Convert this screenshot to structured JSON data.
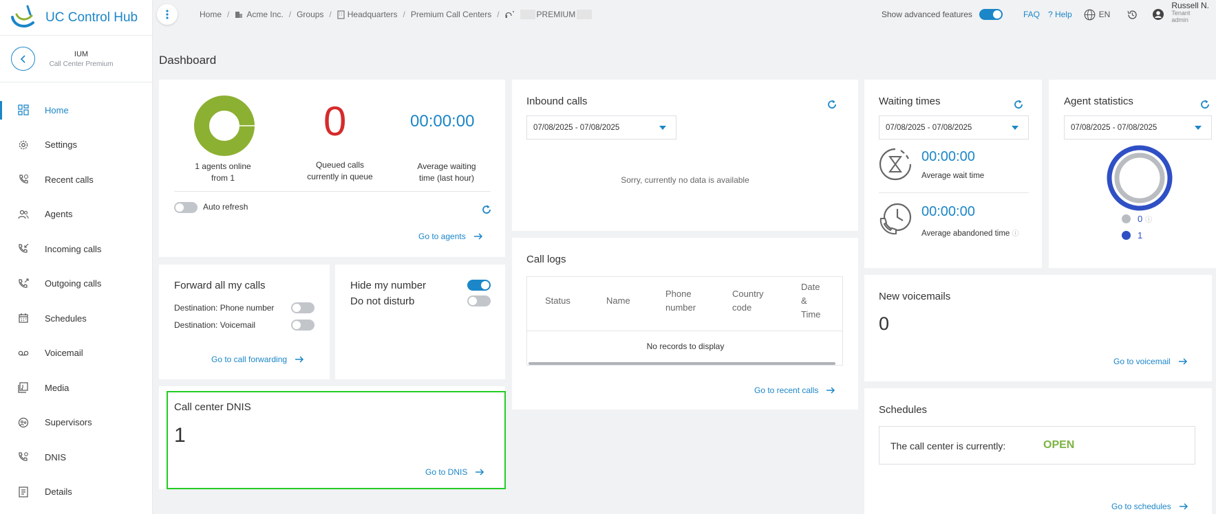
{
  "app": {
    "name": "UC Control Hub"
  },
  "context": {
    "name": "IUM",
    "subtitle": "Call Center Premium"
  },
  "breadcrumbs": [
    "Home",
    "Acme Inc.",
    "Groups",
    "Headquarters",
    "Premium Call Centers",
    "PREMIUM"
  ],
  "topbar": {
    "advanced_label": "Show advanced features",
    "advanced_on": true,
    "faq": "FAQ",
    "help": "? Help",
    "language": "EN",
    "user_name": "Russell N.",
    "user_role_1": "Tenant",
    "user_role_2": "admin"
  },
  "sidebar": {
    "items": [
      {
        "label": "Home",
        "icon": "dashboard-icon",
        "active": true
      },
      {
        "label": "Settings",
        "icon": "gear-icon"
      },
      {
        "label": "Recent calls",
        "icon": "phone-clock-icon"
      },
      {
        "label": "Agents",
        "icon": "users-icon"
      },
      {
        "label": "Incoming calls",
        "icon": "phone-incoming-icon"
      },
      {
        "label": "Outgoing calls",
        "icon": "phone-outgoing-icon"
      },
      {
        "label": "Schedules",
        "icon": "calendar-icon"
      },
      {
        "label": "Voicemail",
        "icon": "voicemail-icon"
      },
      {
        "label": "Media",
        "icon": "media-icon"
      },
      {
        "label": "Supervisors",
        "icon": "supervisor-icon"
      },
      {
        "label": "DNIS",
        "icon": "phone-settings-icon"
      },
      {
        "label": "Details",
        "icon": "details-icon"
      }
    ]
  },
  "page_title": "Dashboard",
  "overview": {
    "agents_caption_1": "1 agents online",
    "agents_caption_2": "from 1",
    "agents_online_fraction": 1.0,
    "queued_value": "0",
    "queued_caption_1": "Queued calls",
    "queued_caption_2": "currently in queue",
    "avg_wait_value": "00:00:00",
    "avg_wait_caption_1": "Average waiting",
    "avg_wait_caption_2": "time (last hour)",
    "auto_refresh_label": "Auto refresh",
    "auto_refresh_on": false,
    "go_label": "Go to agents"
  },
  "forward": {
    "title": "Forward all my calls",
    "dest_phone": "Destination: Phone number",
    "dest_voicemail": "Destination: Voicemail",
    "go_label": "Go to call forwarding"
  },
  "privacy": {
    "hide_number": "Hide my number",
    "hide_number_on": true,
    "dnd": "Do not disturb",
    "dnd_on": false
  },
  "dnis": {
    "title": "Call center DNIS",
    "value": "1",
    "go_label": "Go to DNIS"
  },
  "inbound": {
    "title": "Inbound calls",
    "date_range": "07/08/2025 - 07/08/2025",
    "empty": "Sorry, currently no data is available"
  },
  "call_logs": {
    "title": "Call logs",
    "columns": [
      {
        "line1": "Status"
      },
      {
        "line1": "Name"
      },
      {
        "line1": "Phone",
        "line2": "number"
      },
      {
        "line1": "Country",
        "line2": "code"
      },
      {
        "line1": "Date",
        "line2": "&",
        "line3": "Time"
      }
    ],
    "empty": "No records to display",
    "go_label": "Go to recent calls"
  },
  "waiting": {
    "title": "Waiting times",
    "date_range": "07/08/2025 - 07/08/2025",
    "avg_wait_value": "00:00:00",
    "avg_wait_label": "Average wait time",
    "avg_abandoned_value": "00:00:00",
    "avg_abandoned_label": "Average abandoned time"
  },
  "agent_stats": {
    "title": "Agent statistics",
    "date_range": "07/08/2025 - 07/08/2025",
    "legend": [
      {
        "value": "0",
        "color": "#b9bcc0"
      },
      {
        "value": "1",
        "color": "#2f4fc4"
      }
    ]
  },
  "voicemails": {
    "title": "New voicemails",
    "value": "0",
    "go_label": "Go to voicemail"
  },
  "schedules": {
    "title": "Schedules",
    "status_label": "The call center is currently:",
    "status_value": "OPEN",
    "go_label": "Go to schedules"
  },
  "colors": {
    "accent": "#1b86c8",
    "donut_green": "#8cb032",
    "red": "#d52b2b",
    "open_green": "#7cb342",
    "stats_blue": "#2f4fc4"
  }
}
